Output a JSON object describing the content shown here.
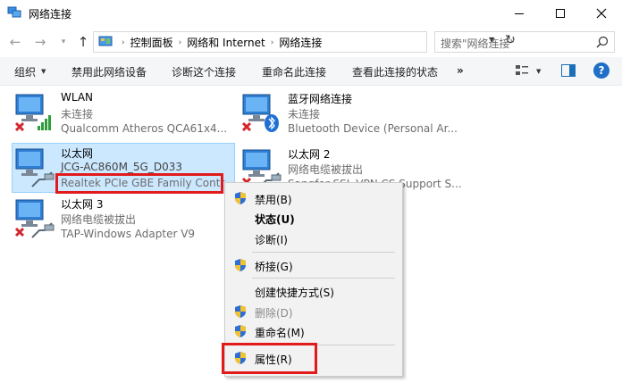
{
  "window": {
    "title": "网络连接"
  },
  "address": {
    "crumbs": [
      "控制面板",
      "网络和 Internet",
      "网络连接"
    ],
    "search_placeholder": "搜索\"网络连接\""
  },
  "commandbar": {
    "organize": "组织",
    "disable": "禁用此网络设备",
    "diagnose": "诊断这个连接",
    "rename": "重命名此连接",
    "status": "查看此连接的状态",
    "more": "»",
    "help": "?"
  },
  "connections": [
    {
      "name": "WLAN",
      "status": "未连接",
      "device": "Qualcomm Atheros QCA61x4..."
    },
    {
      "name": "蓝牙网络连接",
      "status": "未连接",
      "device": "Bluetooth Device (Personal Ar..."
    },
    {
      "name": "以太网",
      "status": "JCG-AC860M_5G_D033",
      "device": "Realtek PCIe GBE Family Contr..."
    },
    {
      "name": "以太网 2",
      "status": "网络电缆被拔出",
      "device": "Sangfor SSL VPN CS Support S..."
    },
    {
      "name": "以太网 3",
      "status": "网络电缆被拔出",
      "device": "TAP-Windows Adapter V9"
    }
  ],
  "context_menu": {
    "disable": "禁用(B)",
    "status": "状态(U)",
    "diagnose": "诊断(I)",
    "bridge": "桥接(G)",
    "shortcut": "创建快捷方式(S)",
    "delete": "删除(D)",
    "rename": "重命名(M)",
    "properties": "属性(R)"
  },
  "colors": {
    "selection_bg": "#cce8ff",
    "highlight": "#e11b1b",
    "accent": "#1f6fc8"
  }
}
